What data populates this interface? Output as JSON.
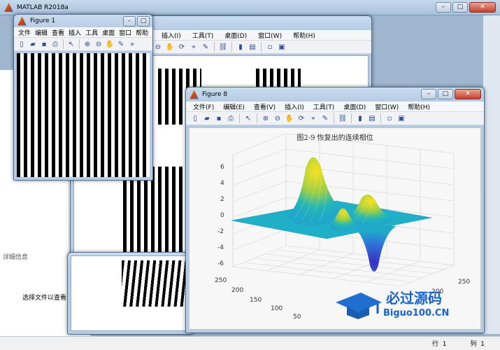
{
  "main_window": {
    "title": "MATLAB R2018a"
  },
  "figure1": {
    "title": "Figure 1",
    "menu": [
      "文件",
      "编辑",
      "查看",
      "插入",
      "工具",
      "桌面",
      "窗口",
      "帮助"
    ],
    "more": "»"
  },
  "figure8": {
    "title": "Figure 8",
    "menu": [
      "文件(F)",
      "编辑(E)",
      "查看(V)",
      "插入(I)",
      "工具(T)",
      "桌面(D)",
      "窗口(W)",
      "帮助(H)"
    ],
    "plot_title": "图2-9 恢复出的连续相位"
  },
  "back_figure": {
    "menu": [
      "插入(I)",
      "工具(T)",
      "桌面(D)",
      "窗口(W)",
      "帮助(H)"
    ]
  },
  "left_panel": {
    "header": "详细信息",
    "message": "选择文件以查看"
  },
  "statusbar": {
    "row_label": "行",
    "row_value": "1",
    "col_label": "列",
    "col_value": "1"
  },
  "watermark": {
    "text": "必过源码",
    "url": "Biguo100.CN"
  },
  "chart_data": {
    "type": "surface",
    "title": "图2-9 恢复出的连续相位",
    "z_ticks": [
      -6,
      -4,
      -2,
      0,
      2,
      4,
      6
    ],
    "y_ticks": [
      50,
      100,
      150,
      200,
      250
    ],
    "x_ticks": [
      200,
      250
    ],
    "zlim": [
      -6,
      6
    ],
    "ylim": [
      0,
      256
    ],
    "xlim": [
      0,
      256
    ],
    "peaks": [
      {
        "name": "main-peak",
        "z": 6.8
      },
      {
        "name": "right-hump",
        "z": 2.5
      },
      {
        "name": "center-hump",
        "z": 1.2
      },
      {
        "name": "trough",
        "z": -6.2
      }
    ],
    "colormap": "parula",
    "grid": true
  }
}
